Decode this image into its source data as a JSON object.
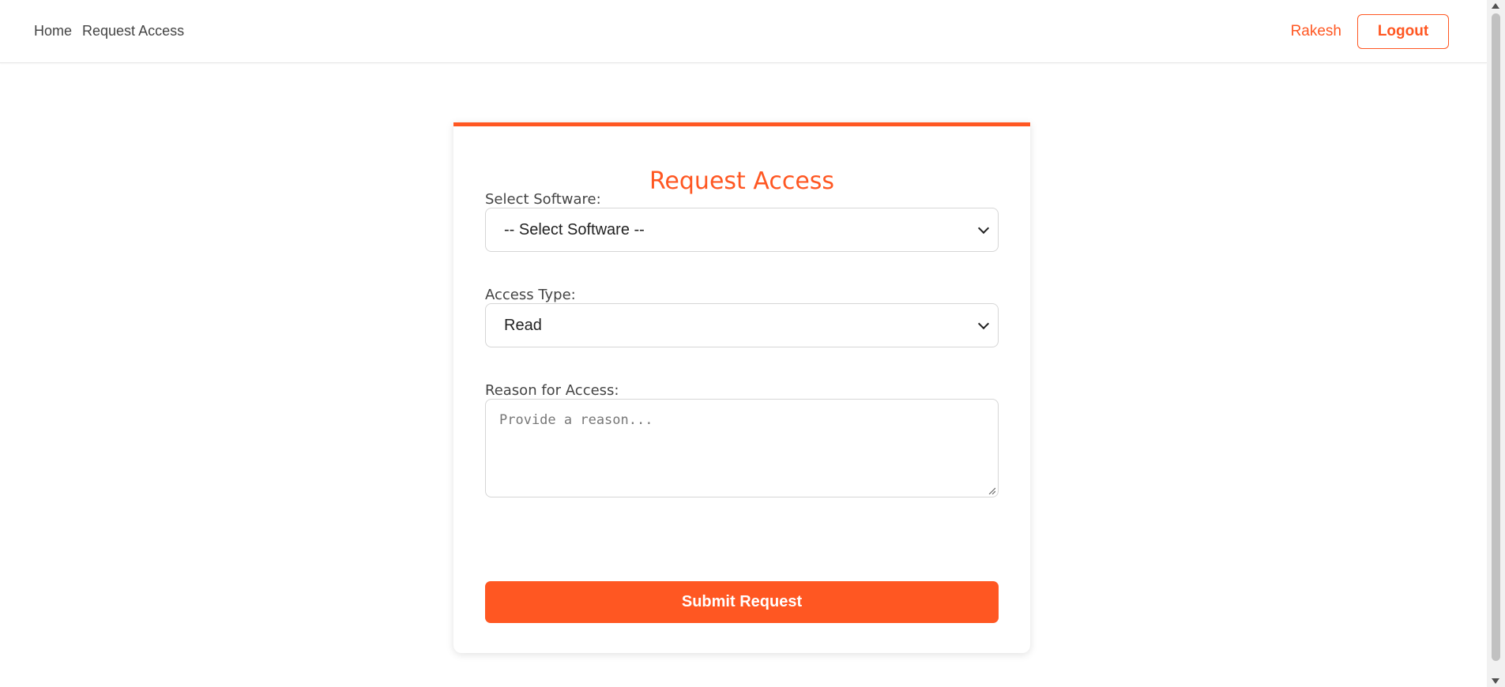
{
  "nav": {
    "links": [
      "Home",
      "Request Access"
    ],
    "user_name": "Rakesh",
    "logout_label": "Logout"
  },
  "form": {
    "title": "Request Access",
    "software_label": "Select Software:",
    "software_value": "-- Select Software --",
    "access_type_label": "Access Type:",
    "access_type_value": "Read",
    "reason_label": "Reason for Access:",
    "reason_placeholder": "Provide a reason...",
    "reason_value": "",
    "submit_label": "Submit Request"
  },
  "colors": {
    "accent": "#ff5722",
    "text": "#444444",
    "border": "#d6d6d6"
  },
  "icons": {
    "select_chevron": "chevron-down-icon",
    "textarea_resize": "resize-handle-icon"
  }
}
